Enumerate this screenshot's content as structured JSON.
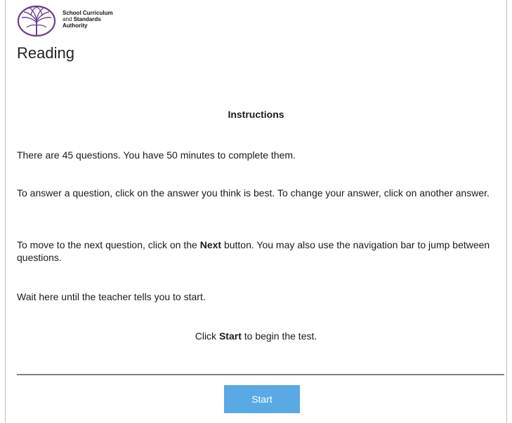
{
  "brand": {
    "line1": "School Curriculum",
    "line2_prefix": "and ",
    "line2_bold": "Standards",
    "line3": "Authority",
    "logo_icon": "tree-circle-logo",
    "logo_color": "#6b3f8f"
  },
  "page": {
    "title": "Reading"
  },
  "instructions": {
    "heading": "Instructions",
    "p1": "There are 45 questions. You have 50 minutes to complete them.",
    "p2": "To answer a question, click on the answer you think is best. To change your answer, click on another answer.",
    "p3_before": "To move to the next question, click on the ",
    "p3_bold": "Next",
    "p3_after": " button. You may also use the navigation bar to jump between questions.",
    "p4": "Wait here until the teacher tells you to start.",
    "p5_before": "Click ",
    "p5_bold": "Start",
    "p5_after": " to begin the test."
  },
  "footer": {
    "start_label": "Start",
    "start_color": "#58a9e4"
  }
}
